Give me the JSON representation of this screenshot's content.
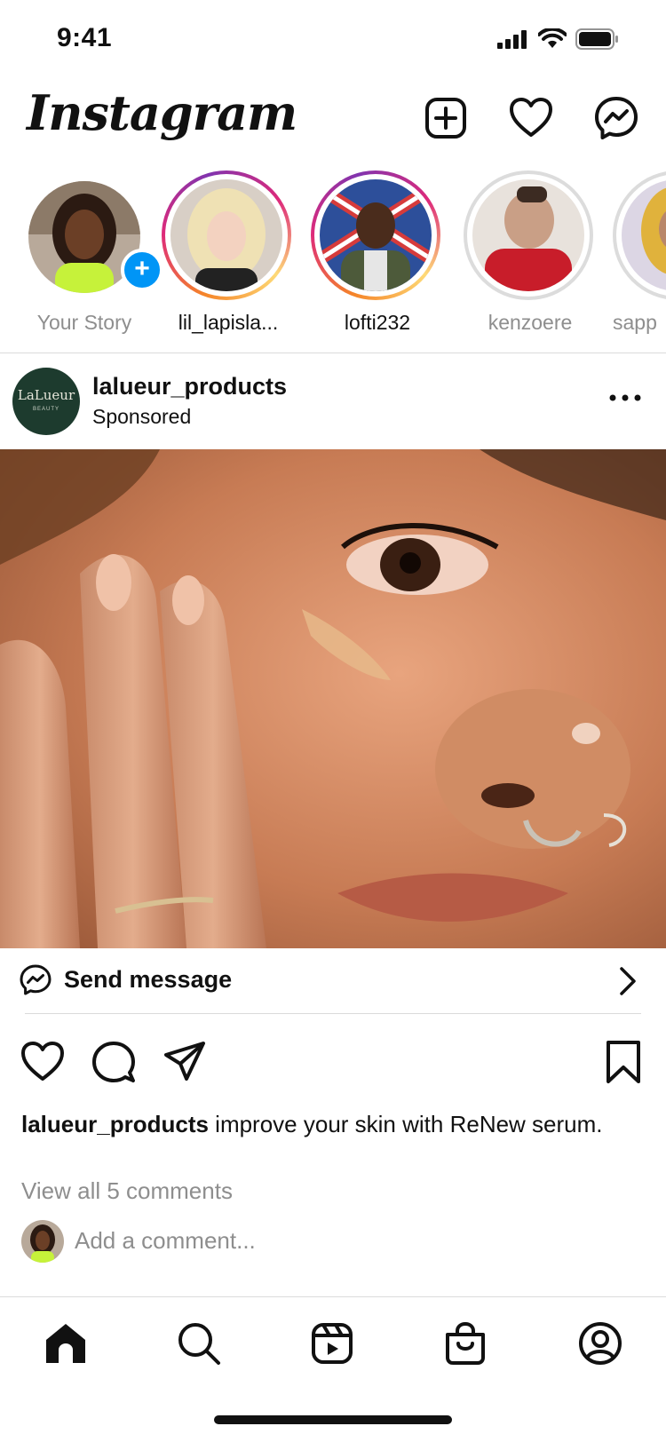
{
  "status_bar": {
    "time": "9:41"
  },
  "header": {
    "logo": "Instagram"
  },
  "stories": [
    {
      "name": "Your Story",
      "state": "own"
    },
    {
      "name": "lil_lapisla...",
      "state": "unseen"
    },
    {
      "name": "lofti232",
      "state": "unseen"
    },
    {
      "name": "kenzoere",
      "state": "seen"
    },
    {
      "name": "sapp",
      "state": "seen"
    }
  ],
  "post": {
    "username": "lalueur_products",
    "subtitle": "Sponsored",
    "brand_logo": "LaLueur",
    "brand_logo_sub": "BEAUTY",
    "send_message": "Send message",
    "caption_user": "lalueur_products",
    "caption_text": " improve your skin with ReNew serum.",
    "view_comments": "View all 5 comments",
    "add_comment_placeholder": "Add a comment..."
  },
  "colors": {
    "accent_blue": "#0095f6",
    "story_ring_gradient": [
      "#f58529",
      "#dd2a7b",
      "#8134af"
    ],
    "brand_avatar_bg": "#1d3b2e"
  },
  "icons": {
    "header": [
      "new-post-icon",
      "heart-icon",
      "messenger-icon"
    ],
    "post_actions": [
      "like-icon",
      "comment-icon",
      "share-icon",
      "bookmark-icon"
    ],
    "nav": [
      "home-icon",
      "search-icon",
      "reels-icon",
      "shop-icon",
      "profile-icon"
    ]
  }
}
